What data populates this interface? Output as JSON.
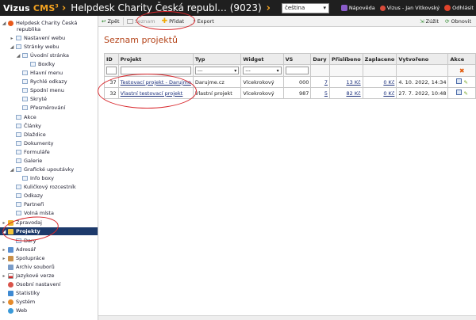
{
  "app": {
    "logo_main": "Vizus",
    "logo_cms": "CMS",
    "logo_sup": "3",
    "site_title": "Helpdesk Charity Česká republ… (9023)",
    "language": "čeština"
  },
  "topbar": {
    "help": "Nápověda",
    "user": "Vizus - Jan Vitkovský",
    "logout": "Odhlásit"
  },
  "toolbar": {
    "back": "Zpět",
    "list": "Seznam",
    "add": "Přidat",
    "export": "Export",
    "shrink": "Zúžit",
    "refresh": "Obnovit"
  },
  "sidebar": {
    "root_line1": "Helpdesk Charity Česká",
    "root_line2": "republika",
    "items": [
      {
        "label": "Nastavení webu"
      },
      {
        "label": "Stránky webu"
      },
      {
        "label": "Úvodní stránka"
      },
      {
        "label": "Boxíky"
      },
      {
        "label": "Hlavní menu"
      },
      {
        "label": "Rychlé odkazy"
      },
      {
        "label": "Spodní menu"
      },
      {
        "label": "Skryté"
      },
      {
        "label": "Přesměrování"
      },
      {
        "label": "Akce"
      },
      {
        "label": "Články"
      },
      {
        "label": "Dlaždice"
      },
      {
        "label": "Dokumenty"
      },
      {
        "label": "Formuláře"
      },
      {
        "label": "Galerie"
      },
      {
        "label": "Grafické upoutávky"
      },
      {
        "label": "Info boxy"
      },
      {
        "label": "Kuličkový rozcestník"
      },
      {
        "label": "Odkazy"
      },
      {
        "label": "Partneři"
      },
      {
        "label": "Volná místa"
      },
      {
        "label": "Zpravodaj"
      },
      {
        "label": "Projekty"
      },
      {
        "label": "Dary"
      },
      {
        "label": "Adresář"
      },
      {
        "label": "Spolupráce"
      },
      {
        "label": "Archiv souborů"
      },
      {
        "label": "Jazykové verze"
      },
      {
        "label": "Osobní nastavení"
      },
      {
        "label": "Statistiky"
      },
      {
        "label": "Systém"
      },
      {
        "label": "Web"
      }
    ]
  },
  "main": {
    "title": "Seznam projektů",
    "columns": [
      "ID",
      "Projekt",
      "Typ",
      "Widget",
      "VS",
      "Dary",
      "Přislíbeno",
      "Zaplaceno",
      "Vytvořeno",
      "Akce"
    ],
    "filter_select_value": "---",
    "rows": [
      {
        "id": "37",
        "projekt": "Testovací projekt - Darujme",
        "typ": "Darujme.cz",
        "widget": "Vícekrokový",
        "vs": "000",
        "dary": "7",
        "prislibeno": "13 Kč",
        "zaplaceno": "0 Kč",
        "vytvoreno": "4. 10. 2022, 14:34"
      },
      {
        "id": "32",
        "projekt": "Vlastní testovací projekt",
        "typ": "Vlastní projekt",
        "widget": "Vícekrokový",
        "vs": "987",
        "dary": "5",
        "prislibeno": "82 Kč",
        "zaplaceno": "0 Kč",
        "vytvoreno": "27. 7. 2022, 10:48"
      }
    ]
  },
  "colors": {
    "topbar": "#1f1f1f",
    "accent_orange": "#f4a321",
    "title_color": "#b4441a",
    "active_nav": "#1d3a6b",
    "annotation": "#d8262b"
  }
}
